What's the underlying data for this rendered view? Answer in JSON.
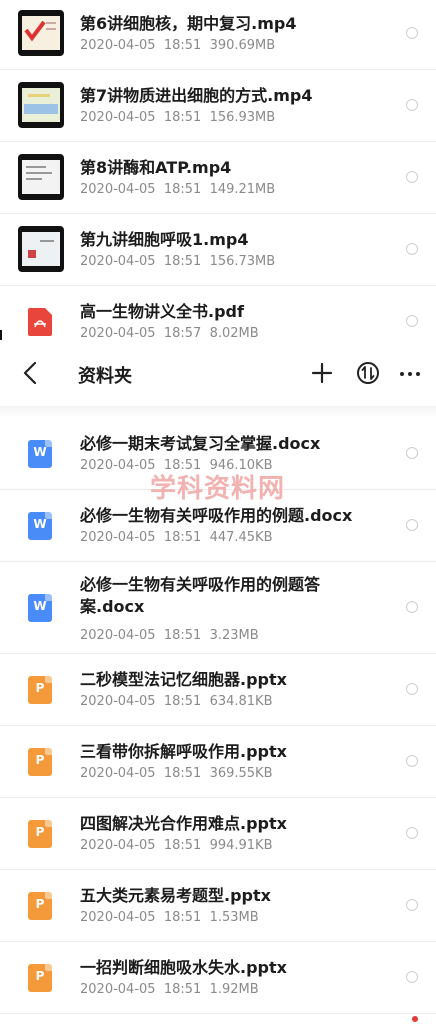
{
  "header": {
    "title": "资料夹",
    "back_icon": "chevron-left-icon",
    "add_icon": "plus-icon",
    "sort_icon": "sort-icon",
    "more_icon": "more-icon"
  },
  "top_files": [
    {
      "name": "第6讲细胞核，期中复习.mp4",
      "date": "2020-04-05",
      "time": "18:51",
      "size": "390.69MB",
      "type": "video"
    },
    {
      "name": "第7讲物质进出细胞的方式.mp4",
      "date": "2020-04-05",
      "time": "18:51",
      "size": "156.93MB",
      "type": "video"
    },
    {
      "name": "第8讲酶和ATP.mp4",
      "date": "2020-04-05",
      "time": "18:51",
      "size": "149.21MB",
      "type": "video"
    },
    {
      "name": "第九讲细胞呼吸1.mp4",
      "date": "2020-04-05",
      "time": "18:51",
      "size": "156.73MB",
      "type": "video"
    },
    {
      "name": "高一生物讲义全书.pdf",
      "date": "2020-04-05",
      "time": "18:57",
      "size": "8.02MB",
      "type": "pdf"
    }
  ],
  "files": [
    {
      "name": "必修一期末考试复习全掌握.docx",
      "date": "2020-04-05",
      "time": "18:51",
      "size": "946.10KB",
      "type": "word",
      "icon_letter": "W"
    },
    {
      "name": "必修一生物有关呼吸作用的例题.docx",
      "date": "2020-04-05",
      "time": "18:51",
      "size": "447.45KB",
      "type": "word",
      "icon_letter": "W"
    },
    {
      "name": "必修一生物有关呼吸作用的例题答案.docx",
      "date": "2020-04-05",
      "time": "18:51",
      "size": "3.23MB",
      "type": "word",
      "icon_letter": "W"
    },
    {
      "name": "二秒模型法记忆细胞器.pptx",
      "date": "2020-04-05",
      "time": "18:51",
      "size": "634.81KB",
      "type": "ppt",
      "icon_letter": "P"
    },
    {
      "name": "三看带你拆解呼吸作用.pptx",
      "date": "2020-04-05",
      "time": "18:51",
      "size": "369.55KB",
      "type": "ppt",
      "icon_letter": "P"
    },
    {
      "name": "四图解决光合作用难点.pptx",
      "date": "2020-04-05",
      "time": "18:51",
      "size": "994.91KB",
      "type": "ppt",
      "icon_letter": "P"
    },
    {
      "name": "五大类元素易考题型.pptx",
      "date": "2020-04-05",
      "time": "18:51",
      "size": "1.53MB",
      "type": "ppt",
      "icon_letter": "P"
    },
    {
      "name": "一招判断细胞吸水失水.pptx",
      "date": "2020-04-05",
      "time": "18:51",
      "size": "1.92MB",
      "type": "ppt",
      "icon_letter": "P"
    }
  ],
  "watermark": "学科资料网",
  "colors": {
    "word": "#4a8cf7",
    "ppt": "#f59a3b",
    "pdf": "#e8453c"
  }
}
